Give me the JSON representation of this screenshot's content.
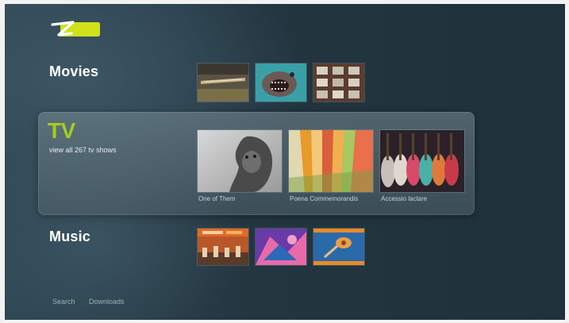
{
  "app": {
    "logo_name": "zune-logo"
  },
  "categories": {
    "movies": {
      "title": "Movies"
    },
    "tv": {
      "title": "TV",
      "subtitle": "view all 267 tv shows",
      "items": [
        {
          "caption": "One of Them"
        },
        {
          "caption": "Poena Commemorandis"
        },
        {
          "caption": "Accessio lactare"
        }
      ]
    },
    "music": {
      "title": "Music"
    }
  },
  "footer": {
    "links": [
      {
        "label": "Search"
      },
      {
        "label": "Downloads"
      }
    ]
  },
  "colors": {
    "accent": "#a6cc1e",
    "background": "#233640",
    "panel": "#5a6f7a"
  }
}
